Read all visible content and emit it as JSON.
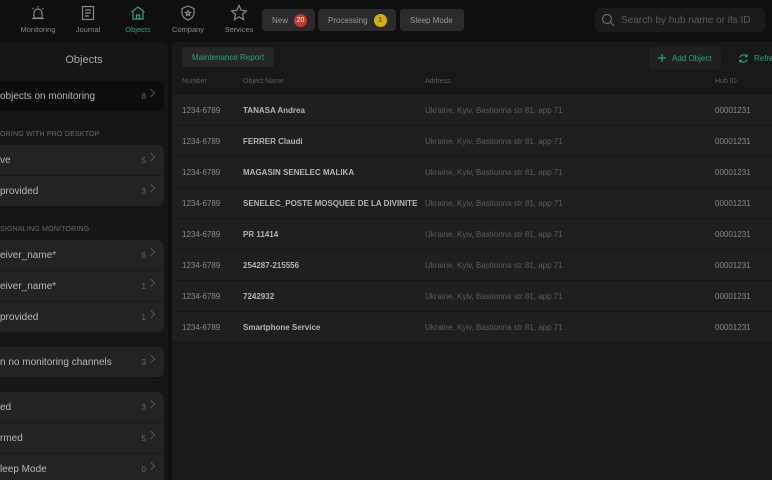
{
  "nav": [
    {
      "label": "Monitoring",
      "icon": "alarm-icon"
    },
    {
      "label": "Journal",
      "icon": "journal-icon"
    },
    {
      "label": "Objects",
      "icon": "home-icon",
      "active": true
    },
    {
      "label": "Company",
      "icon": "shield-icon"
    },
    {
      "label": "Services",
      "icon": "star-icon"
    }
  ],
  "status_tabs": [
    {
      "label": "New",
      "badge": "20",
      "badge_color": "#c0392b"
    },
    {
      "label": "Processing",
      "badge": "1",
      "badge_color": "#d4b106"
    },
    {
      "label": "Sleep Mode"
    }
  ],
  "search": {
    "placeholder": "Search by hub name or its ID"
  },
  "sidebar": {
    "title": "Objects",
    "all": {
      "label": "objects on monitoring",
      "count": "8"
    },
    "section1": {
      "heading": "ORING WITH PRO DESKTOP",
      "items": [
        {
          "label": "ve",
          "count": "5"
        },
        {
          "label": "provided",
          "count": "3"
        }
      ]
    },
    "section2": {
      "heading": "SIGNALING MONITORING",
      "items": [
        {
          "label": "eiver_name*",
          "count": "6"
        },
        {
          "label": "eiver_name*",
          "count": "1"
        },
        {
          "label": "provided",
          "count": "1"
        }
      ]
    },
    "no_channels": {
      "label": "n no monitoring channels",
      "count": "3"
    },
    "section3": {
      "items": [
        {
          "label": "ed",
          "count": "3"
        },
        {
          "label": "rmed",
          "count": "5"
        },
        {
          "label": "leep Mode",
          "count": "0"
        }
      ]
    }
  },
  "toolbar": {
    "maintenance": "Maintenance Report",
    "add": "Add Object",
    "refresh": "Refre"
  },
  "table": {
    "headers": {
      "number": "Number",
      "name": "Object Name",
      "address": "Address",
      "hub": "Hub ID"
    },
    "rows": [
      {
        "number": "1234-6789",
        "name": "TANASA Andrea",
        "address": "Ukraine, Kyiv, Bastionna str 81, app 71",
        "hub": "00001231"
      },
      {
        "number": "1234-6789",
        "name": "FERRER Claudi",
        "address": "Ukraine, Kyiv, Bastionna str 81, app 71",
        "hub": "00001231"
      },
      {
        "number": "1234-6789",
        "name": "MAGASIN SENELEC MALIKA",
        "address": "Ukraine, Kyiv, Bastionna str 81, app 71",
        "hub": "00001231"
      },
      {
        "number": "1234-6789",
        "name": "SENELEC_POSTE MOSQUEE DE LA DIVINITE",
        "address": "Ukraine, Kyiv, Bastionna str 81, app 71",
        "hub": "00001231"
      },
      {
        "number": "1234-6789",
        "name": "PR 11414",
        "address": "Ukraine, Kyiv, Bastionna str 81, app 71",
        "hub": "00001231"
      },
      {
        "number": "1234-6789",
        "name": "254287-215556",
        "address": "Ukraine, Kyiv, Bastionna str 81, app 71",
        "hub": "00001231"
      },
      {
        "number": "1234-6789",
        "name": "7242932",
        "address": "Ukraine, Kyiv, Bastionna str 81, app 71",
        "hub": "00001231"
      },
      {
        "number": "1234-6789",
        "name": "Smartphone Service",
        "address": "Ukraine, Kyiv, Bastionna str 81, app 71",
        "hub": "00001231"
      }
    ]
  }
}
